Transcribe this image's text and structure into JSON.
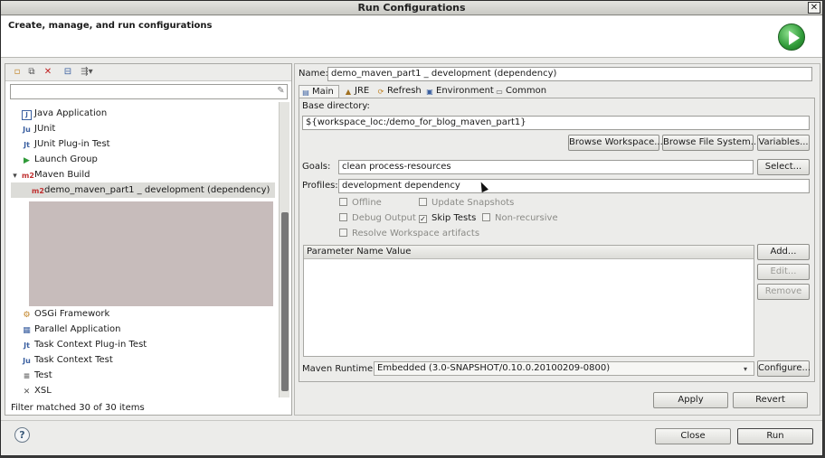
{
  "window": {
    "title": "Run Configurations",
    "close_glyph": "✕"
  },
  "header": {
    "title": "Create, manage, and run configurations",
    "logo_icon": "run-icon"
  },
  "left": {
    "toolbar": [
      "new-config-icon",
      "duplicate-icon",
      "delete-icon",
      "collapse-all-icon",
      "filter-menu-icon"
    ],
    "filter_placeholder": "",
    "tree": [
      {
        "label": "Java Application",
        "icon": "J",
        "color": "#3a5fa0"
      },
      {
        "label": "JUnit",
        "icon": "Ju",
        "color": "#3a5fa0"
      },
      {
        "label": "JUnit Plug-in Test",
        "icon": "Jt",
        "color": "#3a5fa0"
      },
      {
        "label": "Launch Group",
        "icon": "▶",
        "color": "#2f9a38"
      },
      {
        "label": "Maven Build",
        "icon": "m2",
        "color": "#c03030"
      },
      {
        "label": "demo_maven_part1 _ development (dependency)",
        "icon": "m2",
        "color": "#c03030"
      },
      {
        "label": "OSGi Framework",
        "icon": "⚙",
        "color": "#c08020"
      },
      {
        "label": "Parallel Application",
        "icon": "▦",
        "color": "#3a5fa0"
      },
      {
        "label": "Task Context Plug-in Test",
        "icon": "Jt",
        "color": "#3a5fa0"
      },
      {
        "label": "Task Context Test",
        "icon": "Ju",
        "color": "#3a5fa0"
      },
      {
        "label": "Test",
        "icon": "≡",
        "color": "#555555"
      },
      {
        "label": "XSL",
        "icon": "✕",
        "color": "#555555"
      }
    ],
    "expand_glyph": "▾",
    "filter_status": "Filter matched 30 of 30 items"
  },
  "right": {
    "name_label": "Name:",
    "name_value": "demo_maven_part1 _ development (dependency)",
    "tabs": [
      {
        "label": "Main",
        "icon": "▤"
      },
      {
        "label": "JRE",
        "icon": "▲"
      },
      {
        "label": "Refresh",
        "icon": "⟳"
      },
      {
        "label": "Environment",
        "icon": "▣"
      },
      {
        "label": "Common",
        "icon": "▭"
      }
    ],
    "base_dir_label": "Base directory:",
    "base_dir_value": "${workspace_loc:/demo_for_blog_maven_part1}",
    "browse_workspace": "Browse Workspace...",
    "browse_fs": "Browse File System...",
    "variables": "Variables...",
    "goals_label": "Goals:",
    "goals_value": "clean process-resources",
    "select": "Select...",
    "profiles_label": "Profiles:",
    "profiles_value": "development dependency",
    "checks": {
      "offline": "Offline",
      "update_snapshots": "Update Snapshots",
      "debug_output": "Debug Output",
      "skip_tests": "Skip Tests",
      "non_recursive": "Non-recursive",
      "resolve_workspace": "Resolve Workspace artifacts"
    },
    "check_mark": "✓",
    "param_header": "Parameter Name  Value",
    "add": "Add...",
    "edit": "Edit...",
    "remove": "Remove",
    "runtime_label": "Maven Runtime:",
    "runtime_value": "Embedded (3.0-SNAPSHOT/0.10.0.20100209-0800)",
    "runtime_arrow": "▾",
    "configure": "Configure...",
    "apply": "Apply",
    "revert": "Revert"
  },
  "footer": {
    "help": "?",
    "close": "Close",
    "run": "Run"
  }
}
